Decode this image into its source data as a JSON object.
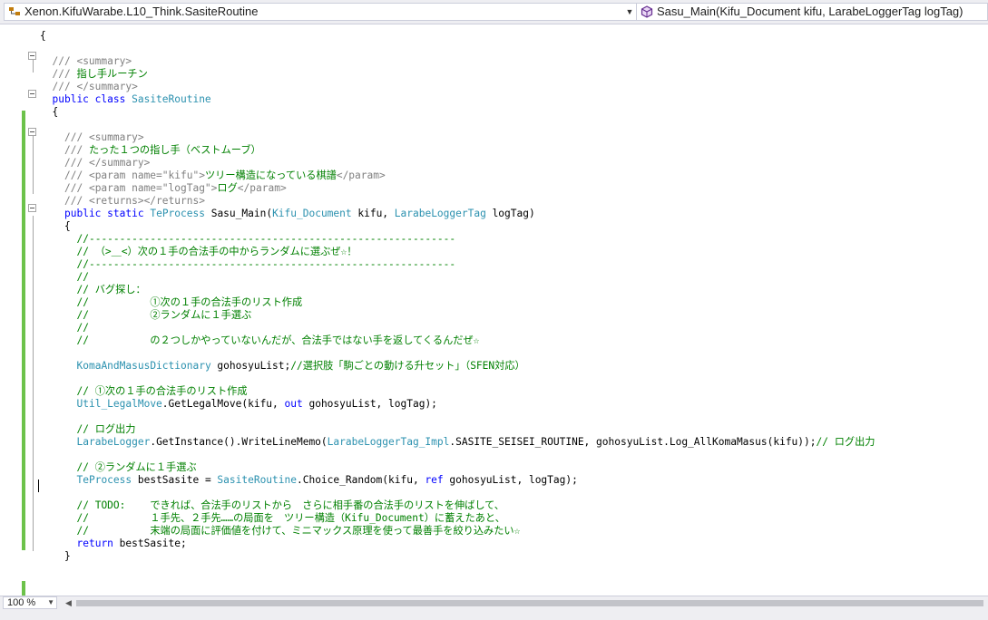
{
  "nav": {
    "type_selector": "Xenon.KifuWarabe.L10_Think.SasiteRoutine",
    "member_selector": "Sasu_Main(Kifu_Document kifu, LarabeLoggerTag logTag)",
    "type_icon": "class-icon",
    "member_icon": "method-icon"
  },
  "code": {
    "lines": [
      [
        [
          "t",
          "{"
        ]
      ],
      [],
      [
        [
          "xd",
          "/// "
        ],
        [
          "xd",
          "<summary>"
        ]
      ],
      [
        [
          "xd",
          "/// "
        ],
        [
          "cm",
          "指し手ルーチン"
        ]
      ],
      [
        [
          "xd",
          "/// "
        ],
        [
          "xd",
          "</summary>"
        ]
      ],
      [
        [
          "kw",
          "public"
        ],
        [
          "t",
          " "
        ],
        [
          "kw",
          "class"
        ],
        [
          "t",
          " "
        ],
        [
          "ty",
          "SasiteRoutine"
        ]
      ],
      [
        [
          "t",
          "{"
        ]
      ],
      [],
      [
        [
          "xd",
          "/// "
        ],
        [
          "xd",
          "<summary>"
        ]
      ],
      [
        [
          "xd",
          "/// "
        ],
        [
          "cm",
          "たった１つの指し手（ベストムーブ）"
        ]
      ],
      [
        [
          "xd",
          "/// "
        ],
        [
          "xd",
          "</summary>"
        ]
      ],
      [
        [
          "xd",
          "/// "
        ],
        [
          "xd",
          "<param name=\"kifu\">"
        ],
        [
          "cm",
          "ツリー構造になっている棋譜"
        ],
        [
          "xd",
          "</param>"
        ]
      ],
      [
        [
          "xd",
          "/// "
        ],
        [
          "xd",
          "<param name=\"logTag\">"
        ],
        [
          "cm",
          "ログ"
        ],
        [
          "xd",
          "</param>"
        ]
      ],
      [
        [
          "xd",
          "/// "
        ],
        [
          "xd",
          "<returns></returns>"
        ]
      ],
      [
        [
          "kw",
          "public"
        ],
        [
          "t",
          " "
        ],
        [
          "kw",
          "static"
        ],
        [
          "t",
          " "
        ],
        [
          "ty",
          "TeProcess"
        ],
        [
          "t",
          " Sasu_Main("
        ],
        [
          "ty",
          "Kifu_Document"
        ],
        [
          "t",
          " kifu, "
        ],
        [
          "ty",
          "LarabeLoggerTag"
        ],
        [
          "t",
          " logTag)"
        ]
      ],
      [
        [
          "t",
          "{"
        ]
      ],
      [
        [
          "cm",
          "//------------------------------------------------------------"
        ]
      ],
      [
        [
          "cm",
          "// （>＿<）次の１手の合法手の中からランダムに選ぶぜ☆！"
        ]
      ],
      [
        [
          "cm",
          "//------------------------------------------------------------"
        ]
      ],
      [
        [
          "cm",
          "//"
        ]
      ],
      [
        [
          "cm",
          "// バグ探し："
        ]
      ],
      [
        [
          "cm",
          "//          ①次の１手の合法手のリスト作成"
        ]
      ],
      [
        [
          "cm",
          "//          ②ランダムに１手選ぶ"
        ]
      ],
      [
        [
          "cm",
          "//"
        ]
      ],
      [
        [
          "cm",
          "//          の２つしかやっていないんだが、合法手ではない手を返してくるんだぜ☆"
        ]
      ],
      [],
      [
        [
          "ty",
          "KomaAndMasusDictionary"
        ],
        [
          "t",
          " gohosyuList;"
        ],
        [
          "cm",
          "//選択肢「駒ごとの動ける升セット」（SFEN対応）"
        ]
      ],
      [],
      [
        [
          "cm",
          "// ①次の１手の合法手のリスト作成"
        ]
      ],
      [
        [
          "ty",
          "Util_LegalMove"
        ],
        [
          "t",
          ".GetLegalMove(kifu, "
        ],
        [
          "kw",
          "out"
        ],
        [
          "t",
          " gohosyuList, logTag);"
        ]
      ],
      [],
      [
        [
          "cm",
          "// ログ出力"
        ]
      ],
      [
        [
          "ty",
          "LarabeLogger"
        ],
        [
          "t",
          ".GetInstance().WriteLineMemo("
        ],
        [
          "ty",
          "LarabeLoggerTag_Impl"
        ],
        [
          "t",
          ".SASITE_SEISEI_ROUTINE, gohosyuList.Log_AllKomaMasus(kifu));"
        ],
        [
          "cm",
          "// ログ出力"
        ]
      ],
      [],
      [
        [
          "cm",
          "// ②ランダムに１手選ぶ"
        ]
      ],
      [
        [
          "ty",
          "TeProcess"
        ],
        [
          "t",
          " bestSasite = "
        ],
        [
          "ty",
          "SasiteRoutine"
        ],
        [
          "t",
          ".Choice_Random(kifu, "
        ],
        [
          "kw",
          "ref"
        ],
        [
          "t",
          " gohosyuList, logTag);"
        ]
      ],
      [],
      [
        [
          "cm",
          "// TODO:    できれば、合法手のリストから　さらに相手番の合法手のリストを伸ばして、"
        ]
      ],
      [
        [
          "cm",
          "//          １手先、２手先……の局面を　ツリー構造（Kifu_Document）に蓄えたあと、"
        ]
      ],
      [
        [
          "cm",
          "//          末端の局面に評価値を付けて、ミニマックス原理を使って最善手を絞り込みたい☆"
        ]
      ],
      [
        [
          "kw",
          "return"
        ],
        [
          "t",
          " bestSasite;"
        ]
      ],
      [
        [
          "t",
          "}"
        ]
      ]
    ]
  },
  "statusbar": {
    "zoom": "100 %"
  }
}
